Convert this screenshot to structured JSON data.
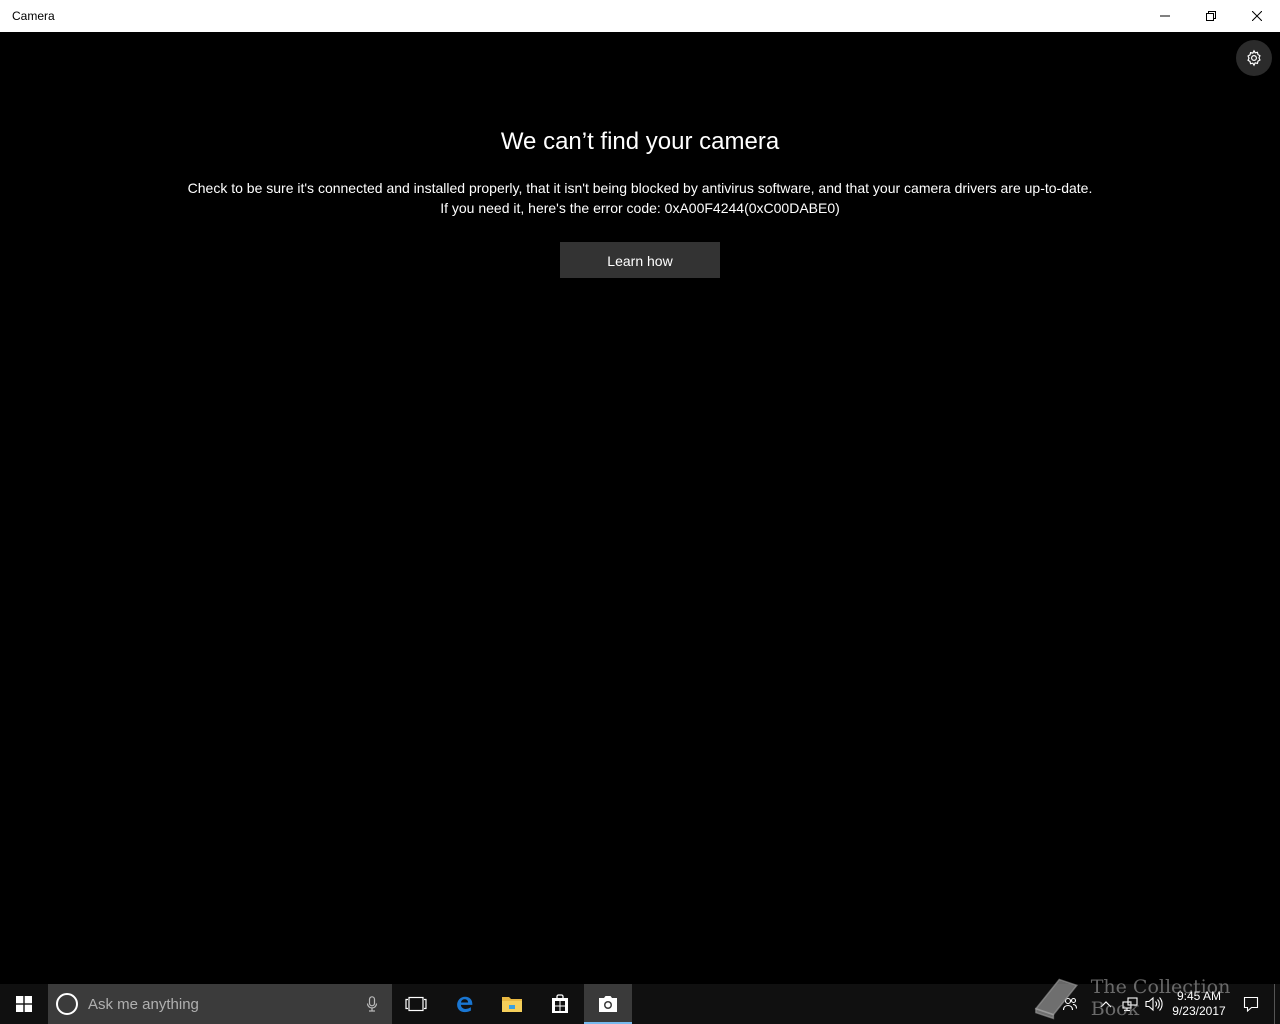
{
  "window": {
    "title": "Camera",
    "controls": {
      "minimize_icon": "minimize-icon",
      "restore_icon": "restore-icon",
      "close_icon": "close-icon"
    }
  },
  "app": {
    "settings_icon": "gear-icon",
    "heading": "We can’t find your camera",
    "message_line1": "Check to be sure it's connected and installed properly, that it isn't being blocked by antivirus software, and that your camera drivers are up-to-date.",
    "message_line2": "If you need it, here's the error code: 0xA00F4244(0xC00DABE0)",
    "learn_button": "Learn how"
  },
  "taskbar": {
    "search_placeholder": "Ask me anything",
    "pinned": [
      "task-view-icon",
      "edge-icon",
      "file-explorer-icon",
      "store-icon",
      "camera-icon"
    ],
    "active_app": "camera-icon",
    "accent": "#76b9ed",
    "clock": {
      "time": "9:45 AM",
      "date": "9/23/2017"
    }
  },
  "watermark": {
    "text": "The Collection Book"
  }
}
